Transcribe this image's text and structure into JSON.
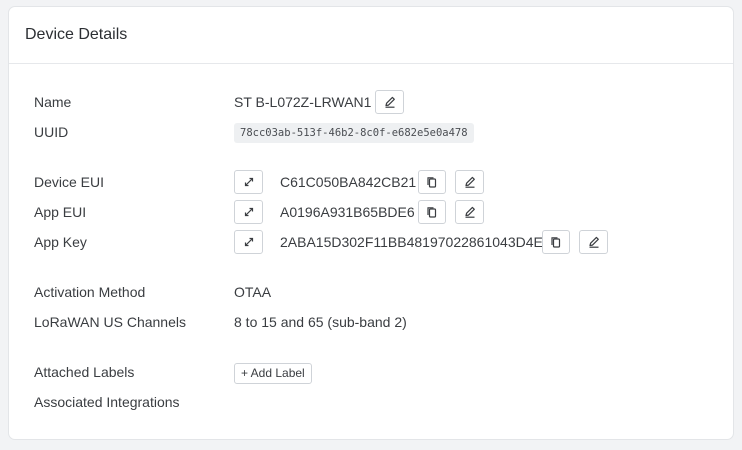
{
  "card": {
    "title": "Device Details"
  },
  "fields": {
    "name": {
      "label": "Name",
      "value": "ST B-L072Z-LRWAN1"
    },
    "uuid": {
      "label": "UUID",
      "value": "78cc03ab-513f-46b2-8c0f-e682e5e0a478"
    },
    "device_eui": {
      "label": "Device EUI",
      "value": "C61C050BA842CB21"
    },
    "app_eui": {
      "label": "App EUI",
      "value": "A0196A931B65BDE6"
    },
    "app_key": {
      "label": "App Key",
      "value": "2ABA15D302F11BB48197022861043D4E"
    },
    "activation_method": {
      "label": "Activation Method",
      "value": "OTAA"
    },
    "lorawan_channels": {
      "label": "LoRaWAN US Channels",
      "value": "8 to 15 and 65 (sub-band 2)"
    },
    "attached_labels": {
      "label": "Attached Labels",
      "add_button": "+ Add Label"
    },
    "associated_integrations": {
      "label": "Associated Integrations"
    }
  },
  "icons": {
    "edit": "pencil-icon",
    "copy": "copy-icon",
    "expand": "expand-icon"
  }
}
